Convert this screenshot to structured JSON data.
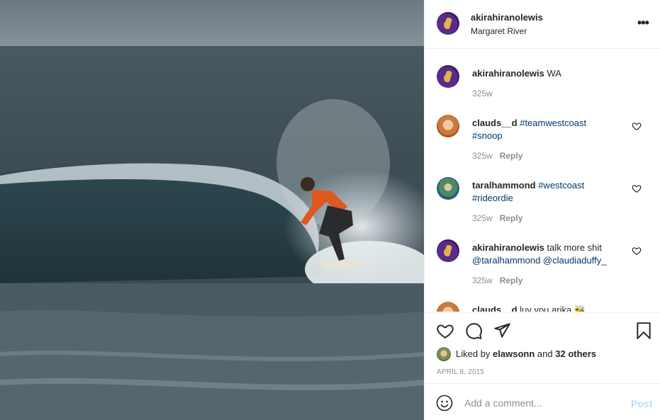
{
  "post": {
    "username": "akirahiranolewis",
    "location": "Margaret River",
    "more_label": "•••"
  },
  "comments": [
    {
      "username": "akirahiranolewis",
      "text": "WA",
      "tags": "",
      "tags2": "",
      "time": "325w",
      "reply": ""
    },
    {
      "username": "clauds__d",
      "text": "",
      "tags": "#teamwestcoast",
      "tags2": "#snoop",
      "time": "325w",
      "reply": "Reply"
    },
    {
      "username": "taralhammond",
      "text": "",
      "tags": "#westcoast",
      "tags2": "#rideordie",
      "time": "325w",
      "reply": "Reply"
    },
    {
      "username": "akirahiranolewis",
      "text": "talk more shit",
      "tags": "",
      "tags2": "@taralhammond @claudiaduffy_",
      "time": "325w",
      "reply": "Reply"
    },
    {
      "username": "clauds__d",
      "text": "luv you arika 🐝",
      "tags": "",
      "tags2": "",
      "time": "",
      "reply": ""
    }
  ],
  "likes": {
    "prefix": "Liked by",
    "user": "elawsonn",
    "and": "and",
    "others": "32 others"
  },
  "date": "APRIL 8, 2015",
  "comment_box": {
    "placeholder": "Add a comment...",
    "post_label": "Post"
  },
  "icons": [
    "heart-icon",
    "comment-icon",
    "share-icon",
    "bookmark-icon",
    "smile-icon",
    "more-icon"
  ],
  "colors": {
    "link": "#00376b",
    "muted": "#8e8e8e",
    "post_disabled": "#b2dffc"
  }
}
